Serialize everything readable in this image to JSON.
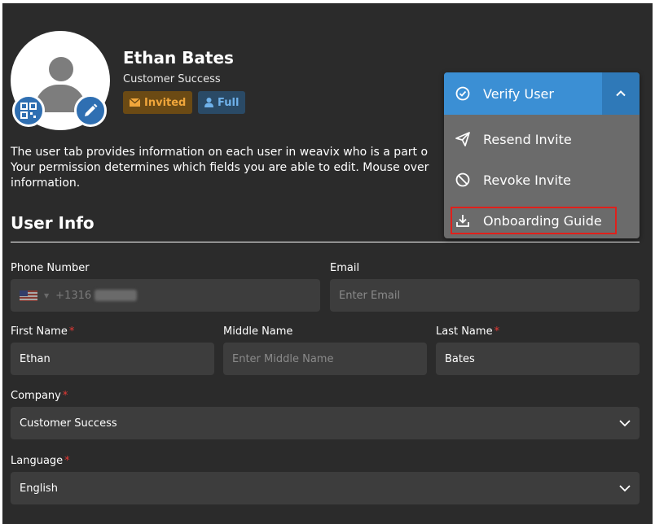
{
  "user": {
    "name": "Ethan Bates",
    "role": "Customer Success",
    "status_badge": "Invited",
    "access_badge": "Full"
  },
  "description": "The user tab provides information on each user in weavix who is a part o\nYour permission determines which fields you are able to edit. Mouse over\ninformation.",
  "section_title": "User Info",
  "menu": {
    "primary_label": "Verify User",
    "items": [
      {
        "label": "Resend Invite",
        "icon": "send-icon"
      },
      {
        "label": "Revoke Invite",
        "icon": "ban-icon"
      },
      {
        "label": "Onboarding Guide",
        "icon": "download-icon"
      }
    ]
  },
  "form": {
    "phone": {
      "label": "Phone Number",
      "code": "+1316"
    },
    "email": {
      "label": "Email",
      "placeholder": "Enter Email"
    },
    "first_name": {
      "label": "First Name",
      "value": "Ethan",
      "required": "*"
    },
    "middle_name": {
      "label": "Middle Name",
      "placeholder": "Enter Middle Name"
    },
    "last_name": {
      "label": "Last Name",
      "value": "Bates",
      "required": "*"
    },
    "company": {
      "label": "Company",
      "value": "Customer Success",
      "required": "*"
    },
    "language": {
      "label": "Language",
      "value": "English",
      "required": "*"
    }
  },
  "colors": {
    "background": "#2b2b2b",
    "accent": "#3b8fd4",
    "invited": "#f0a63b",
    "required": "#e53935"
  }
}
